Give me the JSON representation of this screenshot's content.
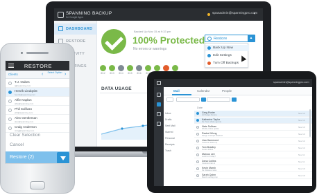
{
  "laptop": {
    "brand": "SPANNING BACKUP",
    "brand_sub": "for Google Apps",
    "user_email": "spanadmin@spanningpro.com",
    "nav": [
      {
        "label": "DASHBOARD",
        "active": true
      },
      {
        "label": "RESTORE",
        "active": false
      },
      {
        "label": "ACTIVITY",
        "active": false
      },
      {
        "label": "SETTINGS",
        "active": false
      }
    ],
    "status": {
      "last_backup": "Backed Up Nov 15 at 9:33 pm",
      "headline": "100% Protected",
      "subline": "No errors or warnings"
    },
    "restore_button": "Restore",
    "menu": [
      {
        "label": "Back Up Now",
        "icon": "upload-icon",
        "color": "#2a93d5"
      },
      {
        "label": "Edit Settings",
        "icon": "gear-icon",
        "color": "#2a93d5"
      },
      {
        "label": "Turn Off Backups",
        "icon": "close-icon",
        "color": "#e25c2b"
      }
    ],
    "days": [
      {
        "label": "8/12",
        "color": "#7ab948"
      },
      {
        "label": "8/13",
        "color": "#7ab948"
      },
      {
        "label": "8/14",
        "color": "#7f8a93"
      },
      {
        "label": "8/15",
        "color": "#7ab948"
      },
      {
        "label": "8/16",
        "color": "#7f8a93"
      },
      {
        "label": "8/17",
        "color": "#7ab948"
      },
      {
        "label": "8/18",
        "color": "#7ab948"
      },
      {
        "label": "8/19",
        "color": "#e25c2b"
      },
      {
        "label": "8/20",
        "color": "#7ab948"
      }
    ],
    "data_usage_title": "DATA USAGE"
  },
  "tablet": {
    "user_email": "spanadmin@spanningpro.com",
    "tabs": [
      {
        "label": "Mail",
        "active": true
      },
      {
        "label": "Calendar",
        "active": false
      },
      {
        "label": "People",
        "active": false
      }
    ],
    "column_header": "Date",
    "tree": [
      "Inbox",
      "Drafts",
      "Sent Mail",
      "Starred",
      "Personal",
      "Receipts",
      "Trash"
    ],
    "rows": [
      {
        "name": "Greg Porter",
        "sub": "Q3 Budget Review",
        "date": "Nov 14",
        "selected": true
      },
      {
        "name": "Katherine Taylor",
        "sub": "Re: Team offsite agenda",
        "date": "Nov 14",
        "selected": true
      },
      {
        "name": "Nate Sullivan",
        "sub": "Weekly status update",
        "date": "Nov 13",
        "selected": false
      },
      {
        "name": "Rachel Wong",
        "sub": "Design mockups attached",
        "date": "Nov 13",
        "selected": false
      },
      {
        "name": "Lisa Hammond",
        "sub": "Customer follow up",
        "date": "Nov 12",
        "selected": false
      },
      {
        "name": "Tom Bradley",
        "sub": "Invoice #4421",
        "date": "Nov 12",
        "selected": false
      },
      {
        "name": "Marcus Lee",
        "sub": "Lunch on Friday?",
        "date": "Nov 11",
        "selected": false
      },
      {
        "name": "Dana Collins",
        "sub": "Contract draft v2",
        "date": "Nov 11",
        "selected": false
      },
      {
        "name": "Kevin Marsh",
        "sub": "Re: Release notes",
        "date": "Nov 10",
        "selected": false
      },
      {
        "name": "Sarah Quinn",
        "sub": "Board meeting prep",
        "date": "Nov 10",
        "selected": false
      }
    ]
  },
  "phone": {
    "title": "RESTORE",
    "tab_left": "Clients",
    "tab_right": "Select Option",
    "items": [
      {
        "name": "T.J. Oakes",
        "email": "tj@spanning.com",
        "selected": false
      },
      {
        "name": "Henrik Lindqvist",
        "email": "henrik@spanning.com",
        "selected": true
      },
      {
        "name": "Alfie Kaplan",
        "email": "alfie@spanning.com",
        "selected": false
      },
      {
        "name": "Phil Sullivan",
        "email": "phil@spanning.com",
        "selected": false
      },
      {
        "name": "Alex Gentleman",
        "email": "alex@spanning.com",
        "selected": false
      },
      {
        "name": "Craig Anderson",
        "email": "craig@spanning.com",
        "selected": false
      }
    ],
    "clear_selection": "Clear Selection",
    "cancel": "Cancel",
    "restore_count": "Restore (2)"
  }
}
